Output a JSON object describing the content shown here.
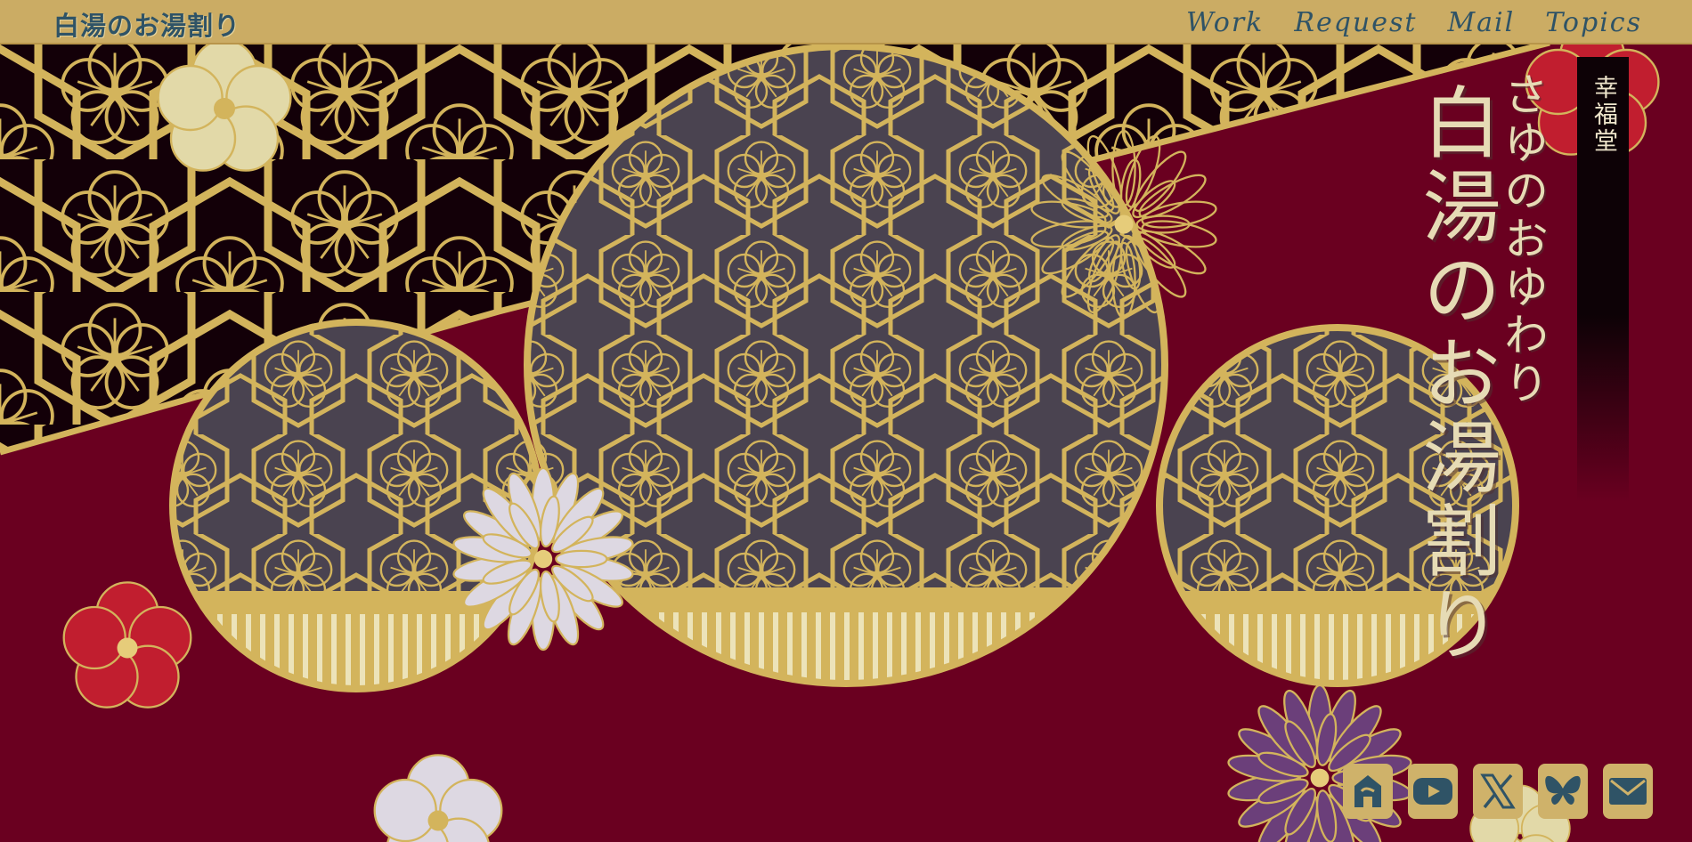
{
  "site": {
    "logo_text": "白湯のお湯割り"
  },
  "nav": {
    "items": [
      "Work",
      "Request",
      "Mail",
      "Topics"
    ]
  },
  "hero": {
    "title": "白湯のお湯割り",
    "subtitle": "さゆのおゆわり",
    "banner_text": "幸福堂"
  },
  "social": {
    "icons": [
      "home-icon",
      "youtube-icon",
      "x-icon",
      "bluesky-icon",
      "mail-icon"
    ]
  },
  "theme": {
    "crimson": "#6a0020",
    "dark": "#130008",
    "gold": "#d3b45c",
    "slate": "#4a4350",
    "text_accent": "#2f5366"
  }
}
